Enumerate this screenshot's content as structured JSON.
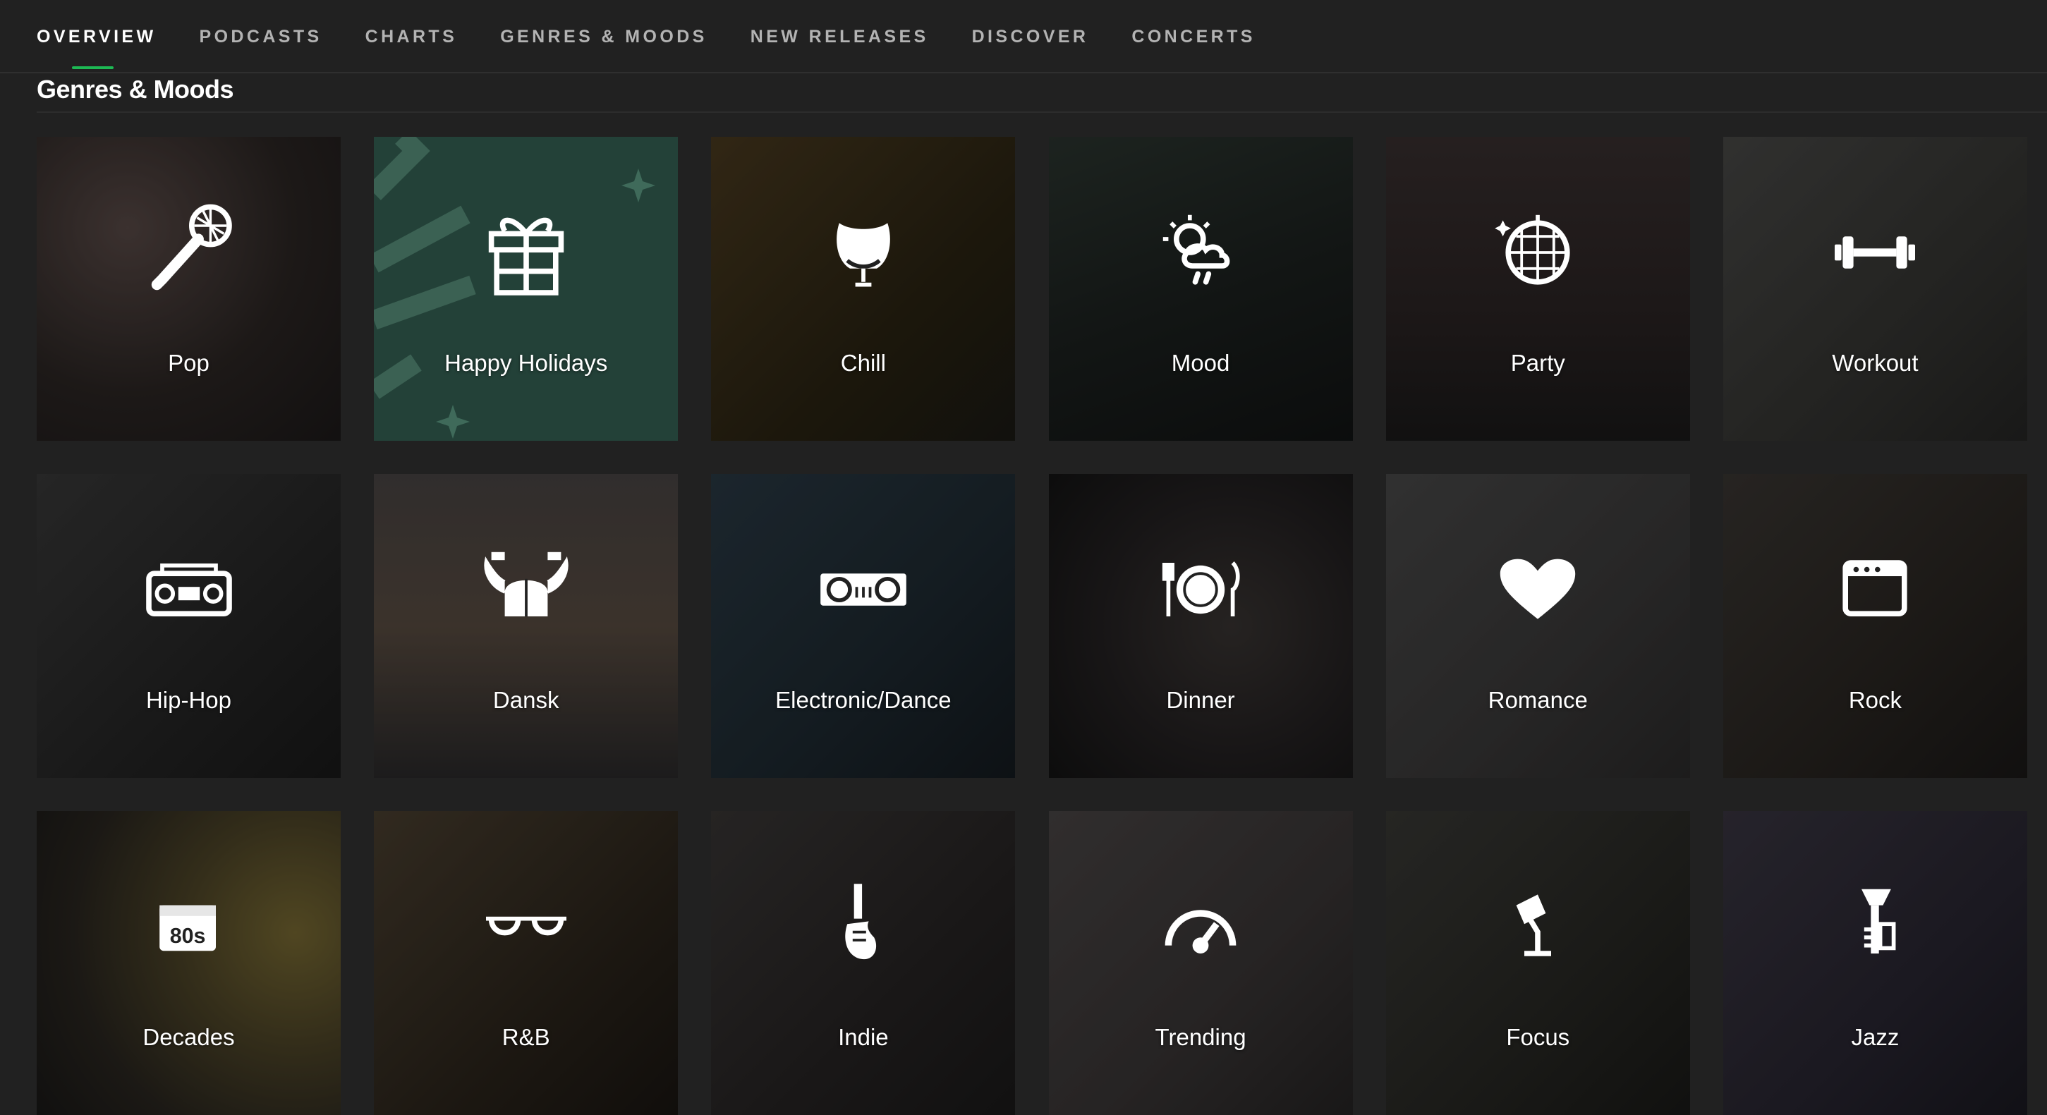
{
  "nav": {
    "tabs": [
      {
        "label": "OVERVIEW",
        "active": true
      },
      {
        "label": "PODCASTS",
        "active": false
      },
      {
        "label": "CHARTS",
        "active": false
      },
      {
        "label": "GENRES & MOODS",
        "active": false
      },
      {
        "label": "NEW RELEASES",
        "active": false
      },
      {
        "label": "DISCOVER",
        "active": false
      },
      {
        "label": "CONCERTS",
        "active": false
      }
    ],
    "accent_color": "#1db954"
  },
  "section": {
    "title": "Genres & Moods"
  },
  "categories": [
    {
      "label": "Pop",
      "icon": "microphone-icon"
    },
    {
      "label": "Happy Holidays",
      "icon": "gift-icon"
    },
    {
      "label": "Chill",
      "icon": "egg-chair-icon"
    },
    {
      "label": "Mood",
      "icon": "sun-cloud-rain-icon"
    },
    {
      "label": "Party",
      "icon": "disco-ball-icon"
    },
    {
      "label": "Workout",
      "icon": "dumbbell-icon"
    },
    {
      "label": "Hip-Hop",
      "icon": "boombox-icon"
    },
    {
      "label": "Dansk",
      "icon": "viking-helmet-icon"
    },
    {
      "label": "Electronic/Dance",
      "icon": "turntables-icon"
    },
    {
      "label": "Dinner",
      "icon": "plate-cutlery-icon"
    },
    {
      "label": "Romance",
      "icon": "heart-icon"
    },
    {
      "label": "Rock",
      "icon": "amplifier-icon"
    },
    {
      "label": "Decades",
      "icon": "calendar-80s-icon"
    },
    {
      "label": "R&B",
      "icon": "sunglasses-icon"
    },
    {
      "label": "Indie",
      "icon": "electric-guitar-icon"
    },
    {
      "label": "Trending",
      "icon": "speedometer-icon"
    },
    {
      "label": "Focus",
      "icon": "desk-lamp-icon"
    },
    {
      "label": "Jazz",
      "icon": "trumpet-icon"
    }
  ],
  "decades_icon_text": "80s"
}
